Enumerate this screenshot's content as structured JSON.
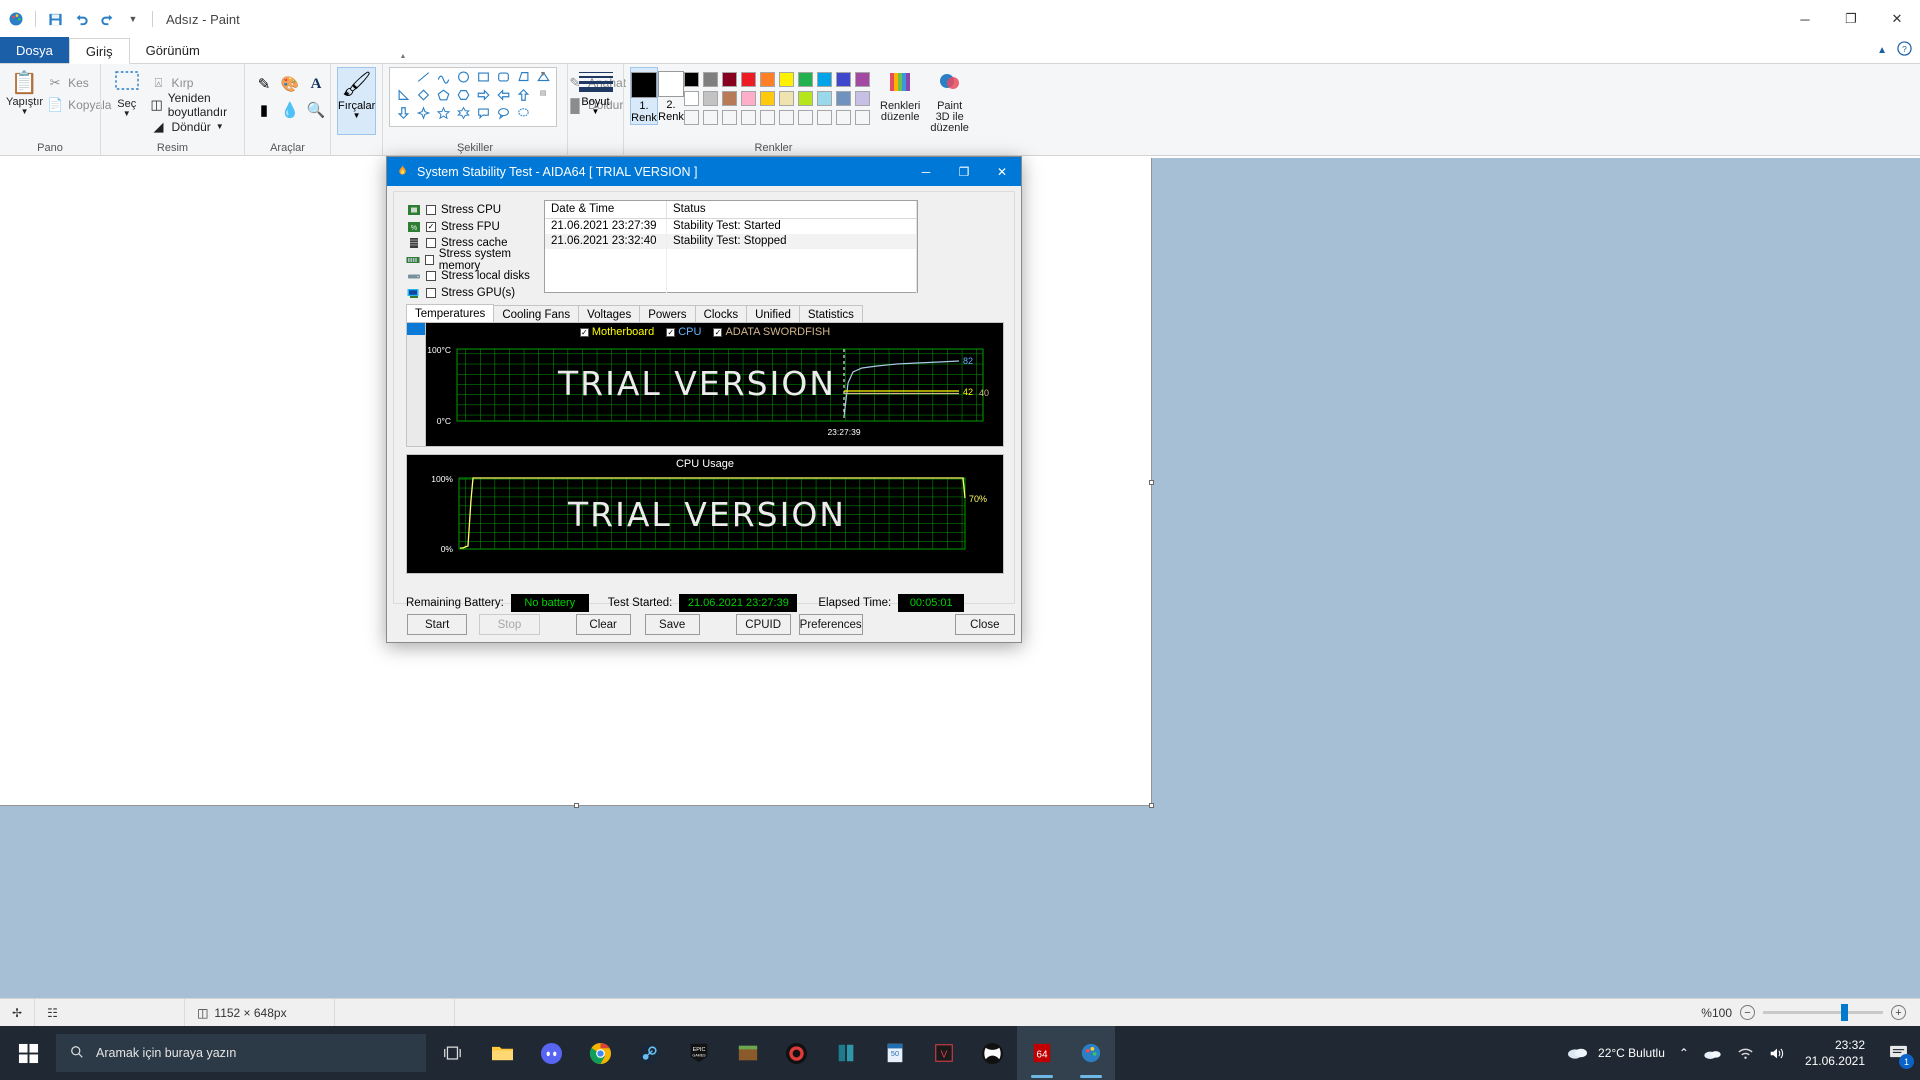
{
  "paint": {
    "title": "Adsız - Paint",
    "quick_access": [
      "save-icon",
      "undo-icon",
      "redo-icon",
      "customize-qat-icon"
    ],
    "window_buttons": {
      "minimize": "─",
      "maximize": "❐",
      "close": "✕"
    },
    "tabs": [
      {
        "label": "Dosya",
        "name": "tab-file"
      },
      {
        "label": "Giriş",
        "name": "tab-home"
      },
      {
        "label": "Görünüm",
        "name": "tab-view"
      }
    ],
    "help_icons": [
      "chevron-up-icon",
      "help-icon"
    ],
    "groups": {
      "clipboard": {
        "label": "Pano",
        "paste": "Yapıştır",
        "cut": "Kes",
        "copy": "Kopyala"
      },
      "image": {
        "label": "Resim",
        "select": "Seç",
        "crop": "Kırp",
        "resize": "Yeniden boyutlandır",
        "rotate": "Döndür"
      },
      "tools": {
        "label": "Araçlar",
        "items": [
          "pencil-icon",
          "fill-icon",
          "text-icon",
          "eraser-icon",
          "color-picker-icon",
          "magnifier-icon"
        ]
      },
      "brushes": {
        "label": "Fırçalar",
        "caption": "Fırçalar"
      },
      "shapes": {
        "label": "Şekiller",
        "outline": "Anahat",
        "fill": "Doldur"
      },
      "size": {
        "label": "Boyut",
        "caption": "Boyut"
      },
      "colors": {
        "label": "Renkler",
        "color1": "1. Renk",
        "color2": "2. Renk",
        "color1_value": "#000000",
        "color2_value": "#ffffff",
        "edit_colors": "Renkleri düzenle",
        "paint3d": "Paint 3D ile düzenle",
        "swatches_row1": [
          "#000000",
          "#7f7f7f",
          "#870020",
          "#ed1c24",
          "#ff7f27",
          "#fff200",
          "#22b14c",
          "#00a2e8",
          "#3f48cc",
          "#a349a4"
        ],
        "swatches_row2": [
          "#ffffff",
          "#c3c3c3",
          "#b97a57",
          "#ffaec9",
          "#ffc90e",
          "#efe4b0",
          "#b5e61d",
          "#99d9ea",
          "#7092be",
          "#c8bfe7"
        ],
        "swatches_row3": [
          "#f5f6f7",
          "#f5f6f7",
          "#f5f6f7",
          "#f5f6f7",
          "#f5f6f7",
          "#f5f6f7",
          "#f5f6f7",
          "#f5f6f7",
          "#f5f6f7",
          "#f5f6f7"
        ]
      }
    },
    "status": {
      "cursor_icon": "cursor-position-icon",
      "selection_icon": "selection-size-icon",
      "canvas_icon": "canvas-size-icon",
      "canvas_size": "1152 × 648px",
      "zoom_label": "%100",
      "zoom_out": "−",
      "zoom_in": "+"
    }
  },
  "aida": {
    "title": "System Stability Test - AIDA64  [ TRIAL VERSION ]",
    "title_icon": "flame-icon",
    "window_buttons": {
      "minimize": "─",
      "maximize": "❐",
      "close": "✕"
    },
    "stress_options": [
      {
        "label": "Stress CPU",
        "checked": false,
        "icon": "cpu-icon"
      },
      {
        "label": "Stress FPU",
        "checked": true,
        "icon": "fpu-icon"
      },
      {
        "label": "Stress cache",
        "checked": false,
        "icon": "cache-icon"
      },
      {
        "label": "Stress system memory",
        "checked": false,
        "icon": "memory-icon"
      },
      {
        "label": "Stress local disks",
        "checked": false,
        "icon": "disk-icon"
      },
      {
        "label": "Stress GPU(s)",
        "checked": false,
        "icon": "gpu-icon"
      }
    ],
    "log": {
      "headers": [
        "Date & Time",
        "Status"
      ],
      "rows": [
        [
          "21.06.2021 23:27:39",
          "Stability Test: Started"
        ],
        [
          "21.06.2021 23:32:40",
          "Stability Test: Stopped"
        ],
        [
          "",
          ""
        ],
        [
          "",
          ""
        ],
        [
          "",
          ""
        ]
      ]
    },
    "tabs": [
      "Temperatures",
      "Cooling Fans",
      "Voltages",
      "Powers",
      "Clocks",
      "Unified",
      "Statistics"
    ],
    "active_tab": "Temperatures",
    "footer": {
      "battery_label": "Remaining Battery:",
      "battery_value": "No battery",
      "started_label": "Test Started:",
      "started_value": "21.06.2021 23:27:39",
      "elapsed_label": "Elapsed Time:",
      "elapsed_value": "00:05:01"
    },
    "buttons": {
      "start": "Start",
      "stop": "Stop",
      "clear": "Clear",
      "save": "Save",
      "cpuid": "CPUID",
      "preferences": "Preferences",
      "close": "Close"
    },
    "watermark": "TRIAL VERSION"
  },
  "chart_data": [
    {
      "type": "line",
      "name": "temperatures-chart",
      "title": "",
      "ylabel": "",
      "ytick_labels": [
        "100°C",
        "0°C"
      ],
      "ylim": [
        0,
        100
      ],
      "xtick_labels": [
        "23:27:39"
      ],
      "grid": true,
      "legend_position": "top-center",
      "legend": [
        {
          "name": "Motherboard",
          "color": "#ffff00",
          "checked": true
        },
        {
          "name": "CPU",
          "color": "#66b3ff",
          "checked": true
        },
        {
          "name": "ADATA SWORDFISH",
          "color": "#d2b48c",
          "checked": true
        }
      ],
      "series": [
        {
          "name": "CPU",
          "color": "#aac8e8",
          "end_value": 82,
          "end_label": "82",
          "values": [
            38,
            62,
            70,
            74,
            76,
            77,
            78,
            79,
            80,
            80,
            81,
            81,
            82,
            82,
            82
          ]
        },
        {
          "name": "Motherboard",
          "color": "#ffff00",
          "end_value": 42,
          "end_label": "42",
          "values": [
            41,
            42,
            42,
            42,
            42,
            42,
            42,
            42,
            42,
            42,
            42,
            42,
            42,
            42,
            42
          ]
        },
        {
          "name": "ADATA SWORDFISH",
          "color": "#d2b48c",
          "end_value": 40,
          "end_label": "40",
          "values": [
            40,
            40,
            40,
            40,
            40,
            40,
            40,
            40,
            40,
            40,
            40,
            40,
            40,
            40,
            40
          ]
        }
      ]
    },
    {
      "type": "line",
      "name": "cpu-usage-chart",
      "title": "CPU Usage",
      "ytick_labels": [
        "100%",
        "0%"
      ],
      "ylim": [
        0,
        100
      ],
      "grid": true,
      "legend_position": "none",
      "series": [
        {
          "name": "CPU Usage",
          "color": "#ffff66",
          "end_value": 70,
          "end_label": "70%",
          "values": [
            0,
            0,
            2,
            100,
            100,
            100,
            100,
            100,
            100,
            100,
            100,
            100,
            100,
            100,
            100,
            100,
            100,
            100,
            70
          ]
        }
      ]
    }
  ],
  "taskbar": {
    "start_icon": "windows-start-icon",
    "search_placeholder": "Aramak için buraya yazın",
    "search_icon": "search-icon",
    "taskview_icon": "task-view-icon",
    "apps": [
      {
        "name": "file-explorer-icon",
        "glyph": "📁",
        "color": "#ffc83d",
        "active": false
      },
      {
        "name": "discord-icon",
        "glyph": "◉",
        "color": "#5865f2",
        "active": false
      },
      {
        "name": "chrome-icon",
        "glyph": "◉",
        "color": "#4285f4",
        "active": false
      },
      {
        "name": "steam-icon",
        "glyph": "✦",
        "color": "#66c0f4",
        "active": false
      },
      {
        "name": "epic-games-icon",
        "glyph": "E",
        "color": "#ffffff",
        "active": false
      },
      {
        "name": "minecraft-icon",
        "glyph": "■",
        "color": "#6aa84f",
        "active": false
      },
      {
        "name": "obs-recorder-icon",
        "glyph": "⬤",
        "color": "#e03a3a",
        "active": false
      },
      {
        "name": "blue-app-icon",
        "glyph": "‖",
        "color": "#1f7a8c",
        "active": false
      },
      {
        "name": "msi-afterburner-icon",
        "glyph": "50",
        "color": "#79c0ff",
        "active": false
      },
      {
        "name": "vegas-icon",
        "glyph": "V",
        "color": "#d43c4c",
        "active": false
      },
      {
        "name": "xbox-icon",
        "glyph": "⬤",
        "color": "#ffffff",
        "active": false
      },
      {
        "name": "aida64-icon",
        "glyph": "64",
        "color": "#ffffff",
        "active": true
      },
      {
        "name": "paint-icon",
        "glyph": "🎨",
        "color": "#6fb8e6",
        "active": true
      }
    ],
    "tray": {
      "weather_icon": "cloud-icon",
      "weather": "22°C  Bulutlu",
      "chevron": "⌃",
      "onedrive_icon": "cloud-sync-icon",
      "network_icon": "wifi-icon",
      "volume_icon": "speaker-icon",
      "time": "23:32",
      "date": "21.06.2021",
      "notification_icon": "notification-icon",
      "notification_count": "1"
    }
  }
}
